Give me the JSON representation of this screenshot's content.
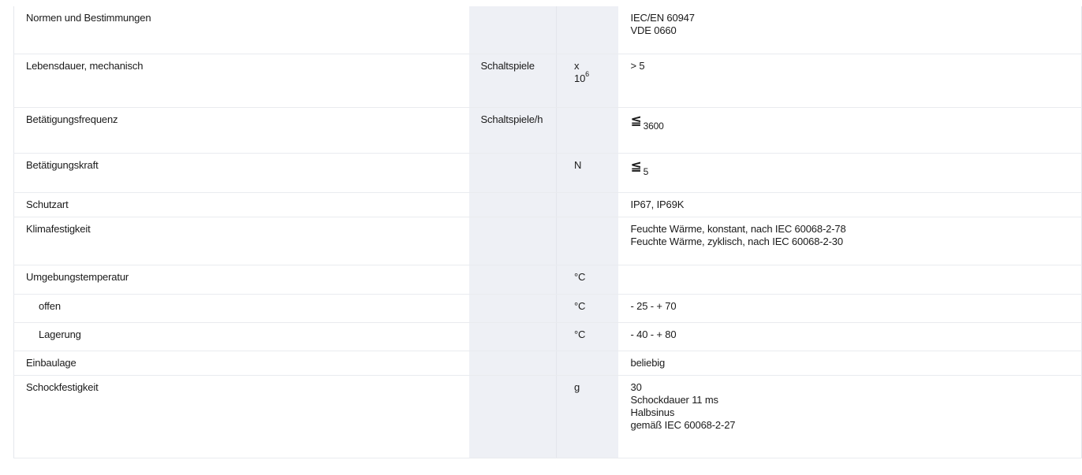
{
  "rows": [
    {
      "label": "Normen und Bestimmungen",
      "unit": "",
      "unit2": "",
      "value": [
        "IEC/EN 60947",
        "VDE 0660"
      ],
      "indent": false,
      "height": 60
    },
    {
      "label": "Lebensdauer, mechanisch",
      "unit": "Schaltspiele",
      "unit2": "x",
      "unit2_base": "10",
      "unit2_exp": "6",
      "value": [
        "> 5"
      ],
      "indent": false,
      "height": 68
    },
    {
      "label": "Betätigungsfrequenz",
      "unit": "Schaltspiele/h",
      "unit2": "",
      "value_symbol": "≦",
      "value_sub": "3600",
      "indent": false,
      "height": 58
    },
    {
      "label": "Betätigungskraft",
      "unit": "",
      "unit2": "N",
      "value_symbol": "≦",
      "value_sub": "5",
      "indent": false,
      "height": 50
    },
    {
      "label": "Schutzart",
      "unit": "",
      "unit2": "",
      "value": [
        "IP67, IP69K"
      ],
      "indent": false,
      "height": 31
    },
    {
      "label": "Klimafestigkeit",
      "unit": "",
      "unit2": "",
      "value": [
        "Feuchte Wärme, konstant, nach IEC 60068-2-78",
        "Feuchte Wärme, zyklisch, nach IEC 60068-2-30"
      ],
      "indent": false,
      "height": 61
    },
    {
      "label": "Umgebungstemperatur",
      "unit": "",
      "unit2": "°C",
      "value": [],
      "indent": false,
      "height": 37
    },
    {
      "label": "offen",
      "unit": "",
      "unit2": "°C",
      "value": [
        "- 25 - + 70"
      ],
      "indent": true,
      "height": 36
    },
    {
      "label": "Lagerung",
      "unit": "",
      "unit2": "°C",
      "value": [
        "- 40 - + 80"
      ],
      "indent": true,
      "height": 36
    },
    {
      "label": "Einbaulage",
      "unit": "",
      "unit2": "",
      "value": [
        "beliebig"
      ],
      "indent": false,
      "height": 31
    },
    {
      "label": "Schockfestigkeit",
      "unit": "",
      "unit2": "g",
      "value": [
        "30",
        "Schockdauer 11 ms",
        "Halbsinus",
        "gemäß IEC 60068-2-27"
      ],
      "indent": false,
      "height": 105
    }
  ]
}
